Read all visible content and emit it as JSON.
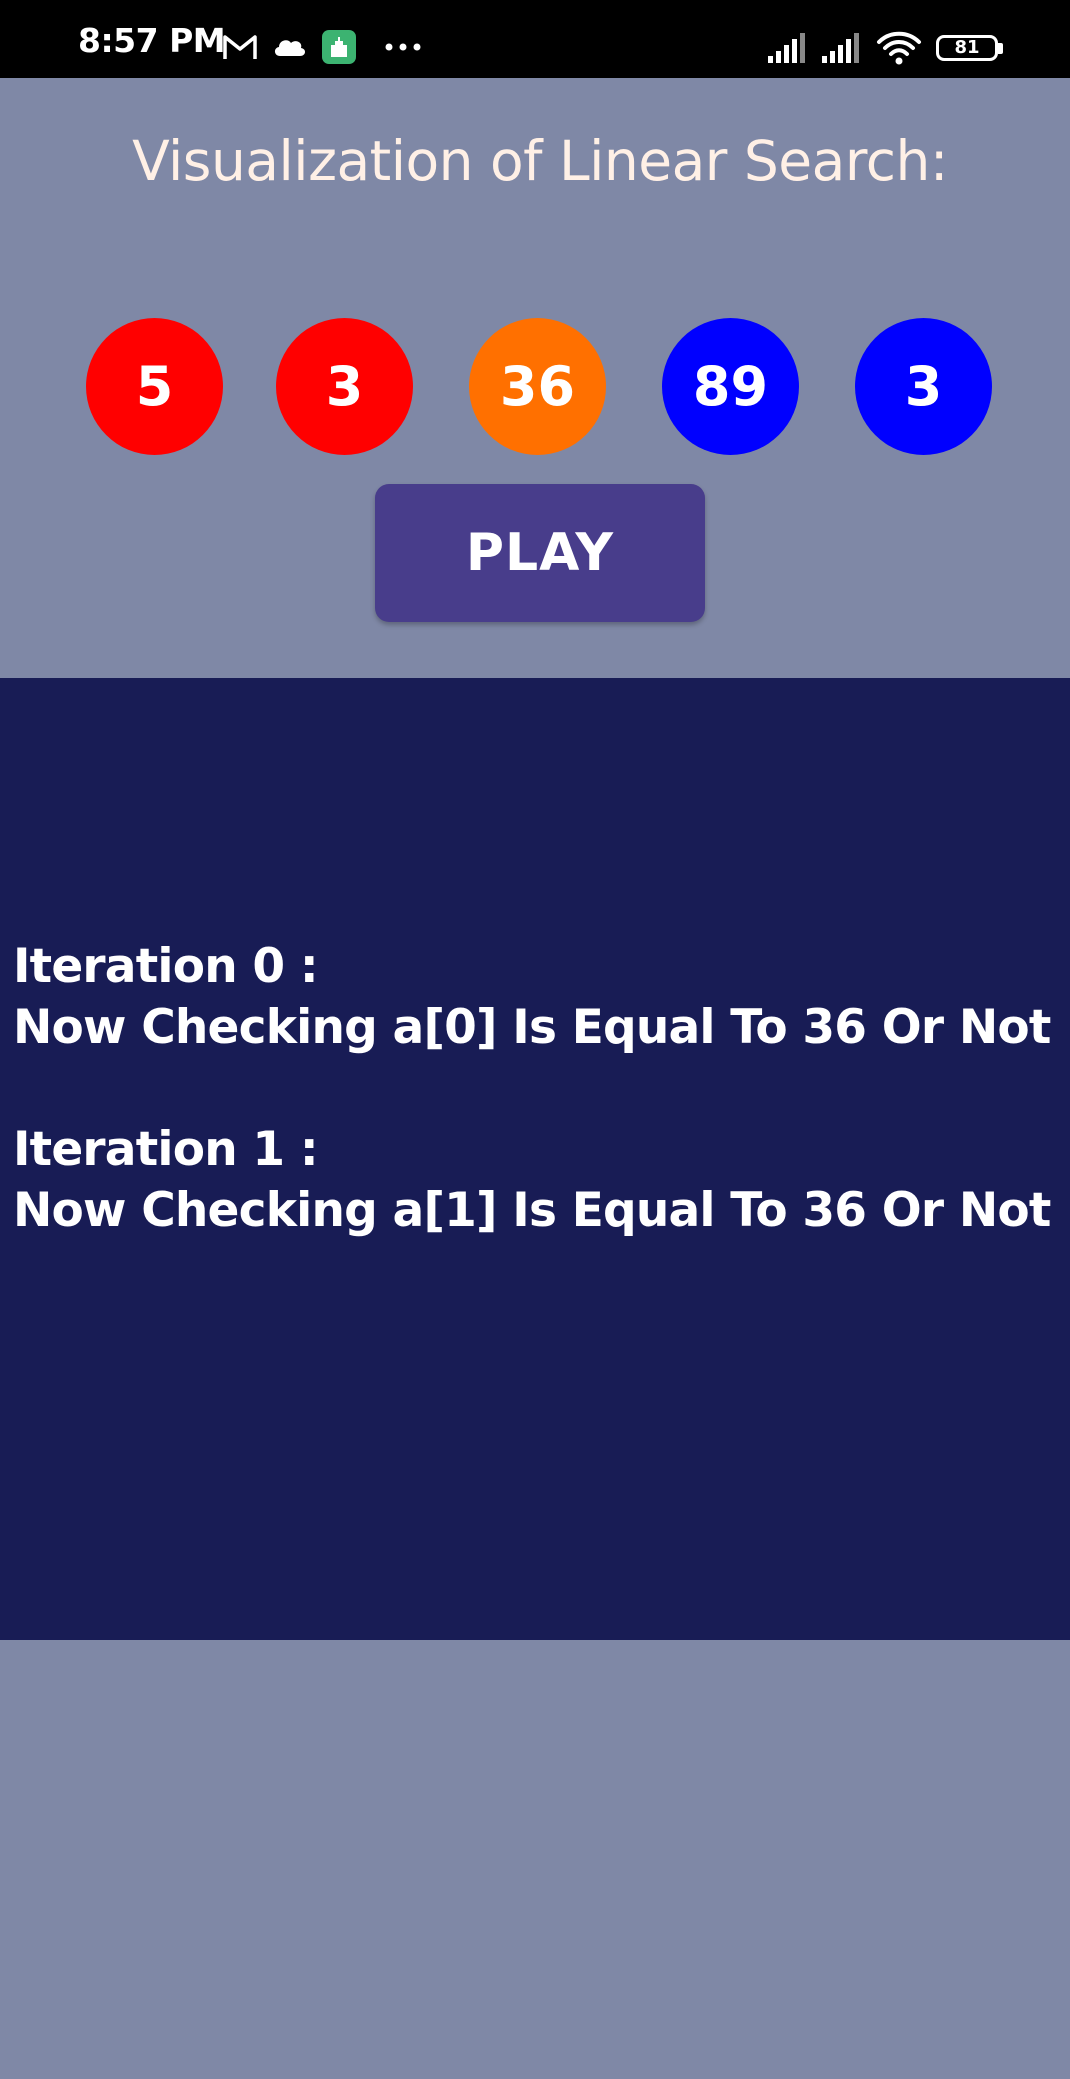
{
  "status_bar": {
    "time": "8:57 PM",
    "icons": [
      "gmail-icon",
      "cloud-icon",
      "app-notification-icon",
      "more-icon",
      "signal-icon",
      "signal-icon-2",
      "wifi-icon",
      "battery-icon"
    ],
    "battery_level": "81"
  },
  "header": {
    "title": "Visualization of Linear Search:"
  },
  "array": {
    "items": [
      {
        "value": "5",
        "color": "#ff0000"
      },
      {
        "value": "3",
        "color": "#ff0000"
      },
      {
        "value": "36",
        "color": "#ff7000"
      },
      {
        "value": "89",
        "color": "#0000ff"
      },
      {
        "value": "3",
        "color": "#0000ff"
      }
    ]
  },
  "controls": {
    "play_label": "PLAY"
  },
  "log": {
    "entries": [
      {
        "heading": "Iteration 0 :",
        "message": "Now Checking a[0] Is Equal To 36 Or Not"
      },
      {
        "heading": "Iteration 1 :",
        "message": "Now Checking a[1] Is Equal To 36 Or Not"
      }
    ]
  },
  "colors": {
    "page_background": "#7f88a6",
    "panel_background": "#181c55",
    "button_background": "#483d8b",
    "title_color": "#fff0e6"
  }
}
